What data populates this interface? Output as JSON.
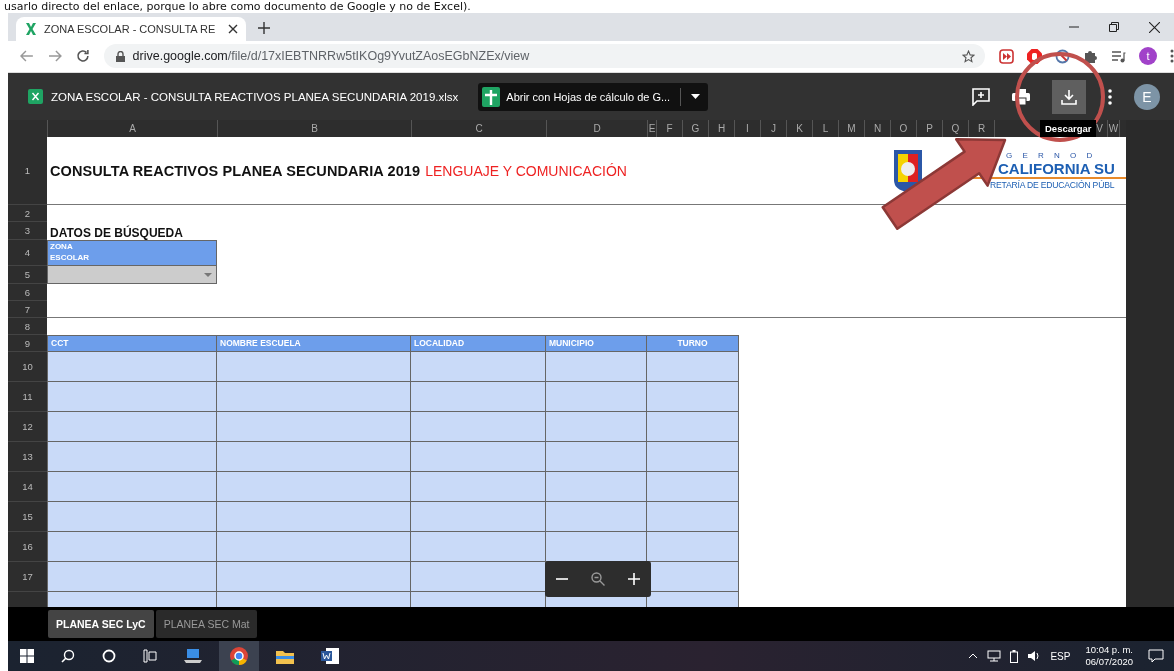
{
  "doc_text": "usarlo directo del enlace, porque lo abre como documento de Google y no de Excel).",
  "browser": {
    "tab_title": "ZONA ESCOLAR - CONSULTA RE",
    "url_domain": "drive.google.com",
    "url_path": "/file/d/17xIEBTNRRw5tIKOg9YvutZAosEGbNZEx/view",
    "profile": "t"
  },
  "drive": {
    "file_name": "ZONA ESCOLAR - CONSULTA REACTIVOS PLANEA SECUNDARIA 2019.xlsx",
    "open_with": "Abrir con Hojas de cálculo de G...",
    "tooltip": "Descargar",
    "avatar": "E"
  },
  "sheet": {
    "columns": [
      "A",
      "B",
      "C",
      "D",
      "E",
      "F",
      "G",
      "H",
      "I",
      "J",
      "K",
      "L",
      "M",
      "N",
      "O",
      "P",
      "Q",
      "R",
      "V",
      "W"
    ],
    "row_numbers": [
      "1",
      "2",
      "3",
      "4",
      "5",
      "6",
      "7",
      "8",
      "9",
      "10",
      "11",
      "12",
      "13",
      "14",
      "15",
      "16",
      "17"
    ],
    "title": "CONSULTA REACTIVOS PLANEA SECUNDARIA 2019",
    "title_subject": "LENGUAJE Y COMUNICACIÓN",
    "logo": {
      "top": "G E R N O D",
      "middle": "CALIFORNIA SU",
      "bottom": "RETARÍA DE EDUCACIÓN PÚBL"
    },
    "section_label": "DATOS DE BÚSQUEDA",
    "filter_label": "ZONA ESCOLAR",
    "table_headers": [
      "CCT",
      "NOMBRE ESCUELA",
      "LOCALIDAD",
      "MUNICIPIO",
      "TURNO"
    ]
  },
  "sheet_tabs": [
    {
      "label": "PLANEA SEC LyC",
      "selected": true
    },
    {
      "label": "PLANEA SEC Mat",
      "selected": false
    }
  ],
  "taskbar": {
    "language": "ESP",
    "time": "10:04 p. m.",
    "date": "06/07/2020"
  }
}
